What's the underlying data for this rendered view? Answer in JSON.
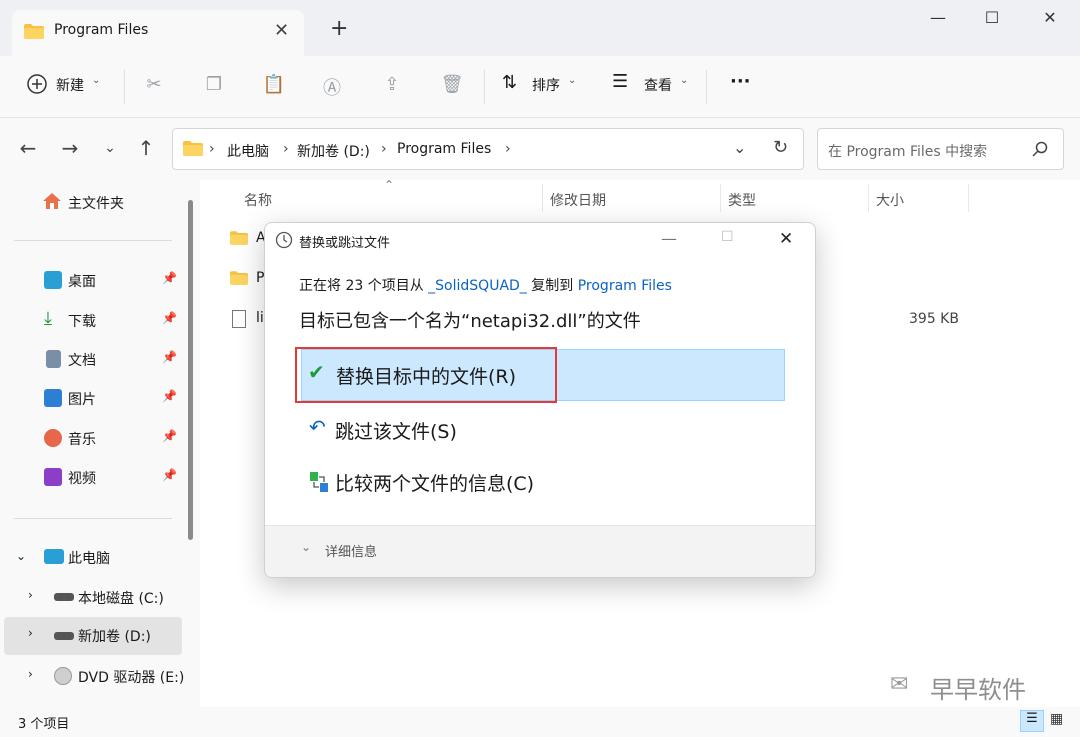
{
  "window": {
    "tab_title": "Program Files",
    "tab_close": "✕",
    "new_tab": "+",
    "minimize": "—",
    "maximize": "☐",
    "close": "✕"
  },
  "toolbar": {
    "new_label": "新建",
    "sort_label": "排序",
    "view_label": "查看",
    "more_label": "···"
  },
  "address": {
    "crumbs": [
      "此电脑",
      "新加卷 (D:)",
      "Program Files"
    ],
    "search_placeholder": "在 Program Files 中搜索"
  },
  "sidebar": {
    "home": "主文件夹",
    "items": [
      {
        "label": "桌面",
        "icon": "desktop-icon"
      },
      {
        "label": "下载",
        "icon": "download-icon"
      },
      {
        "label": "文档",
        "icon": "document-icon"
      },
      {
        "label": "图片",
        "icon": "pictures-icon"
      },
      {
        "label": "音乐",
        "icon": "music-icon"
      },
      {
        "label": "视频",
        "icon": "video-icon"
      }
    ],
    "this_pc": "此电脑",
    "drives": [
      {
        "label": "本地磁盘 (C:)"
      },
      {
        "label": "新加卷 (D:)"
      },
      {
        "label": "DVD 驱动器 (E:)"
      }
    ]
  },
  "columns": {
    "name": "名称",
    "date": "修改日期",
    "type": "类型",
    "size": "大小"
  },
  "files": [
    {
      "name": "A",
      "size": ""
    },
    {
      "name": "P",
      "size": ""
    },
    {
      "name": "li",
      "size": "395 KB"
    }
  ],
  "status": {
    "count": "3 个项目"
  },
  "watermark": {
    "text": "早早软件"
  },
  "dialog": {
    "title": "替换或跳过文件",
    "line1_prefix": "正在将 23 个项目从 ",
    "line1_source": "_SolidSQUAD_",
    "line1_mid": " 复制到 ",
    "line1_dest": "Program Files",
    "line2": "目标已包含一个名为“netapi32.dll”的文件",
    "option_replace": "替换目标中的文件(R)",
    "option_skip": "跳过该文件(S)",
    "option_compare": "比较两个文件的信息(C)",
    "details": "详细信息"
  },
  "colors": {
    "accent": "#0b63c4",
    "selection": "#cce8ff",
    "highlight_red": "#e53935",
    "check_green": "#1e9b3c"
  }
}
